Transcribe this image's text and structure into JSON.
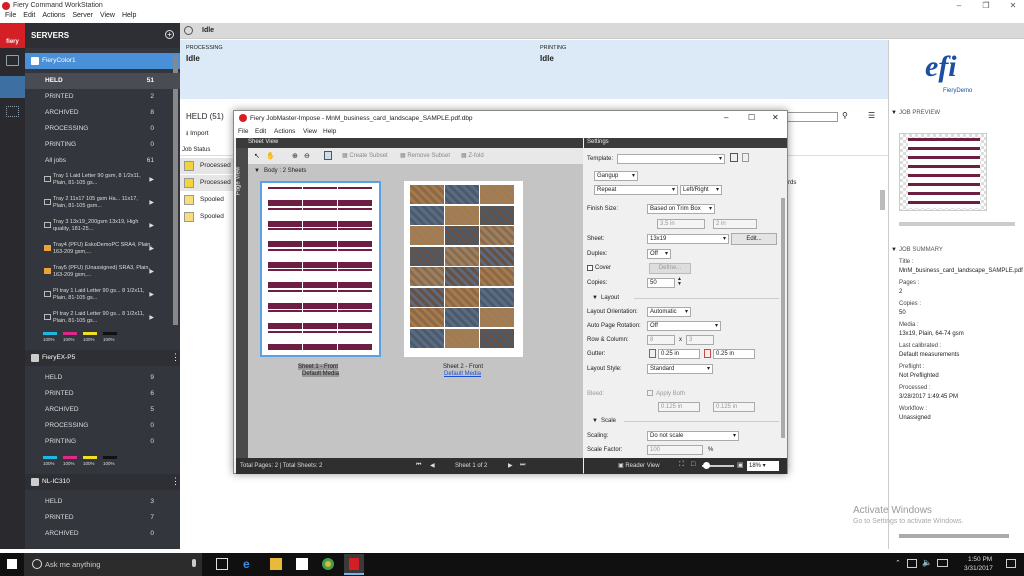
{
  "window": {
    "title": "Fiery Command WorkStation",
    "menu": [
      "File",
      "Edit",
      "Actions",
      "Server",
      "View",
      "Help"
    ]
  },
  "servers_header": "SERVERS",
  "server1": {
    "name": "FieryColor1",
    "queues": [
      {
        "label": "HELD",
        "count": "51"
      },
      {
        "label": "PRINTED",
        "count": "2"
      },
      {
        "label": "ARCHIVED",
        "count": "8"
      },
      {
        "label": "PROCESSING",
        "count": "0"
      },
      {
        "label": "PRINTING",
        "count": "0"
      },
      {
        "label": "All jobs",
        "count": "61"
      }
    ],
    "trays": [
      "Tray 1 Laid Letter 90 gsm, 8 1/2x11, Plain, 81-105 gs...",
      "Tray 2 11x17 105 gsm Ha... 11x17, Plain, 81-105 gsm...",
      "Tray 3 13x19_200gsm 13x19, High quality, 181-25...",
      "Tray4 (PFU) EskoDemoPC SRA4, Plain, 163-209 gsm,...",
      "Tray5 (PFU) (Unassigned) SRA3, Plain, 163-209 gsm,...",
      "PI tray 1 Laid Letter 90 gs... 8 1/2x11, Plain, 81-105 gs...",
      "PI tray 2 Laid Letter 90 gs... 8 1/2x11, Plain, 81-105 gs..."
    ],
    "toner": [
      "100%",
      "100%",
      "100%",
      "100%"
    ]
  },
  "server2": {
    "name": "FieryEX-P5",
    "queues": [
      {
        "label": "HELD",
        "count": "9"
      },
      {
        "label": "PRINTED",
        "count": "6"
      },
      {
        "label": "ARCHIVED",
        "count": "5"
      },
      {
        "label": "PROCESSING",
        "count": "0"
      },
      {
        "label": "PRINTING",
        "count": "0"
      }
    ],
    "toner": [
      "100%",
      "100%",
      "100%",
      "100%"
    ]
  },
  "server3": {
    "name": "NL-IC310",
    "queues": [
      {
        "label": "HELD",
        "count": "3"
      },
      {
        "label": "PRINTED",
        "count": "7"
      },
      {
        "label": "ARCHIVED",
        "count": "0"
      }
    ]
  },
  "topbar": {
    "status": "Idle"
  },
  "status": {
    "processing_label": "PROCESSING",
    "processing_value": "Idle",
    "printing_label": "PRINTING",
    "printing_value": "Idle"
  },
  "held_title": "HELD (51)",
  "import_label": "Import",
  "job_status_header": "Job Status",
  "jobs": [
    "Processed",
    "Processed",
    "Spooled",
    "Spooled"
  ],
  "cards_label": "rds",
  "preview": {
    "brand": "efi",
    "brand_sub": "FieryDemo",
    "job_preview": "JOB PREVIEW",
    "job_summary": "JOB SUMMARY",
    "summary": [
      {
        "k": "Title :",
        "v": "MnM_business_card_landscape_SAMPLE.pdf"
      },
      {
        "k": "Pages :",
        "v": "2"
      },
      {
        "k": "Copies :",
        "v": "50"
      },
      {
        "k": "Media :",
        "v": "13x19, Plain, 64-74 gsm"
      },
      {
        "k": "Last calibrated :",
        "v": "Default measurements"
      },
      {
        "k": "Preflight :",
        "v": "Not Preflighted"
      },
      {
        "k": "Processed :",
        "v": "3/28/2017 1:49:45 PM"
      },
      {
        "k": "Workflow :",
        "v": "Unassigned"
      }
    ]
  },
  "dialog": {
    "title": "Fiery JobMaster-Impose - MnM_business_card_landscape_SAMPLE.pdf.dbp",
    "menu": [
      "File",
      "Edit",
      "Actions",
      "View",
      "Help"
    ],
    "sheet_view": "Sheet View",
    "page_view": "Page View",
    "body": "Body : 2 Sheets",
    "tools": {
      "create_subset": "Create Subset",
      "remove_subset": "Remove Subset",
      "zfold": "Z-fold"
    },
    "sheet1": "Sheet 1 - Front",
    "sheet1_media": "Default Media",
    "sheet2": "Sheet 2 - Front",
    "sheet2_media": "Default Media",
    "footer": {
      "total": "Total Pages: 2 | Total Sheets: 2",
      "sheet_nav": "Sheet 1 of 2",
      "reader": "Reader View",
      "zoom": "18%"
    },
    "settings": {
      "header": "Settings",
      "template_label": "Template:",
      "gangup": "Gangup",
      "repeat": "Repeat",
      "leftright": "Left/Right",
      "finish_size_label": "Finish Size:",
      "finish_size": "Based on Trim Box",
      "w": "3.5 in",
      "h": "2 in",
      "sheet_label": "Sheet:",
      "sheet": "13x19",
      "edit": "Edit...",
      "duplex_label": "Duplex:",
      "duplex": "Off",
      "cover_label": "Cover",
      "define": "Define...",
      "copies_label": "Copies:",
      "copies": "50",
      "layout": "Layout",
      "orient_label": "Layout Orientation:",
      "orient": "Automatic",
      "rotation_label": "Auto Page Rotation:",
      "rotation": "Off",
      "rowcol_label": "Row & Column:",
      "rows": "8",
      "x": "x",
      "cols": "3",
      "gutter_label": "Gutter:",
      "gutter1": "0.25 in",
      "gutter2": "0.25 in",
      "style_label": "Layout Style:",
      "style": "Standard",
      "bleed_label": "Bleed:",
      "apply_both": "Apply Both",
      "bleed1": "0.125 in",
      "bleed2": "0.125 in",
      "scale": "Scale",
      "scaling_label": "Scaling:",
      "scaling": "Do not scale",
      "factor_label": "Scale Factor:",
      "factor": "100",
      "pct": "%"
    }
  },
  "watermark": {
    "line1": "Activate Windows",
    "line2": "Go to Settings to activate Windows."
  },
  "taskbar": {
    "search": "Ask me anything",
    "time": "1:50 PM",
    "date": "3/31/2017"
  }
}
